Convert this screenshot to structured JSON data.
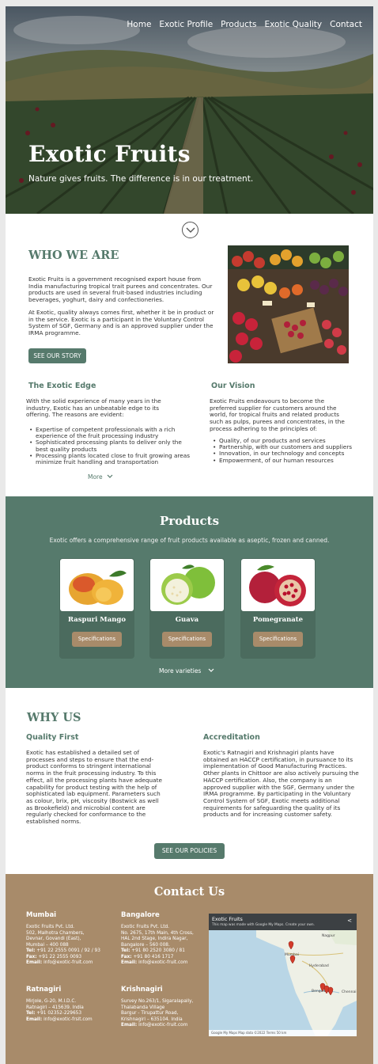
{
  "nav": [
    "Home",
    "Exotic Profile",
    "Products",
    "Exotic Quality",
    "Contact"
  ],
  "hero": {
    "title": "Exotic Fruits",
    "subtitle": "Nature gives fruits. The difference is in our treatment."
  },
  "who": {
    "title": "WHO WE ARE",
    "p1": "Exotic Fruits is a government recognised export house from India manufacturing tropical trait purees and concentrates. Our products are used in several fruit-based industries including beverages, yoghurt, dairy and confectioneries.",
    "p2": "At Exotic, quality always comes first, whether it be in product or in the service. Exotic is a participant in the Voluntary Control System of SGF, Germany and is an approved supplier under the IRMA programme.",
    "button": "SEE OUR STORY"
  },
  "edge": {
    "title": "The Exotic Edge",
    "text": "With the solid experience of many years in the industry, Exotic has an unbeatable edge to its offering. The reasons are evident:",
    "bullets": [
      "Expertise of competent professionals with a rich experience of the fruit processing industry",
      "Sophisticated processing plants to deliver only the best quality products",
      "Processing plants located close to fruit growing areas minimize fruit handling and transportation"
    ],
    "more": "More"
  },
  "vision": {
    "title": "Our Vision",
    "text": "Exotic Fruits endeavours to become the preferred supplier for customers around the world, for tropical fruits and related products such as pulps, purees and concentrates, in the process adhering to the principles of:",
    "bullets": [
      "Quality, of our products and services",
      "Partnership, with our customers and suppliers",
      "Innovation, in our technology and concepts",
      "Empowerment, of our human resources"
    ]
  },
  "products": {
    "title": "Products",
    "subtitle": "Exotic offers a comprehensive range of fruit products available as aseptic, frozen and canned.",
    "items": [
      {
        "name": "Raspuri Mango",
        "button": "Specifications"
      },
      {
        "name": "Guava",
        "button": "Specifications"
      },
      {
        "name": "Pomegranate",
        "button": "Specifications"
      }
    ],
    "more": "More varieties"
  },
  "why": {
    "title": "WHY US",
    "quality_title": "Quality First",
    "quality_text": "Exotic has established a detailed set of processes and steps to ensure that the end-product conforms to stringent international norms in the fruit processing industry. To this effect, all the processing plants have adequate capability for product testing with the help of sophisticated lab equipment. Parameters such as colour, brix, pH, viscosity (Bostwick as well as Brookefield) and microbial content are regularly checked for conformance to the established norms.",
    "accr_title": "Accreditation",
    "accr_text": "Exotic's Ratnagiri and Krishnagiri plants have obtained an HACCP certification, in pursuance to its implementation of Good Manufacturing Practices. Other plants in Chittoor are also actively pursuing the HACCP certification. Also, the company is an approved supplier with the SGF, Germany under the IRMA programme. By participating in the Voluntary Control System of SGF, Exotic meets additional requirements for safeguarding the quality of its products and for increasing customer safety.",
    "button": "SEE OUR POLICIES"
  },
  "contact": {
    "title": "Contact Us",
    "offices": [
      {
        "city": "Mumbai",
        "lines": [
          "Exotic Fruits Pvt. Ltd.",
          "502, Malhotra Chambers,",
          "Devnar, Govandi (East),",
          "Mumbai – 400 088"
        ],
        "tel": "+91 22 2555 0091 / 92 / 93",
        "fax": "+91 22 2555 0093",
        "email": "info@exotic-fruit.com"
      },
      {
        "city": "Bangalore",
        "lines": [
          "Exotic Fruits Pvt. Ltd.",
          "No. 2675, 17th Main, 4th Cross,",
          "HAL 2nd Stage, Indira Nagar,",
          "Bangalore – 560 008."
        ],
        "tel": "+91 80 2520 3080 / 81",
        "fax": "+91 80 416 1717",
        "email": "info@exotic-fruit.com"
      },
      {
        "city": "Ratnagiri",
        "lines": [
          "Mirjole, G-20, M.I.D.C.",
          "Ratnagiri – 415639. India"
        ],
        "tel": "+91 02352-229653",
        "email": "info@exotic-frsit.com"
      },
      {
        "city": "Krishnagiri",
        "lines": [
          "Survey No.263/1, Sigaralapally,",
          "Thalabanda Village",
          "Bargur - Tirupattur Road,",
          "Krishnagiri – 635104. India"
        ],
        "email": "info@exotic-fruit.com"
      }
    ],
    "labels": {
      "tel": "Tel:",
      "fax": "Fax:",
      "email": "Email:"
    },
    "map": {
      "title": "Exotic Fruits",
      "note": "This map was made with Google My Maps. Create your own.",
      "places": [
        "Nagpur",
        "Mumbai",
        "Hyderabad",
        "Bengaluru",
        "Chennai"
      ],
      "footer": "Google My Maps  Map data ©2022   Terms   50 km"
    }
  }
}
